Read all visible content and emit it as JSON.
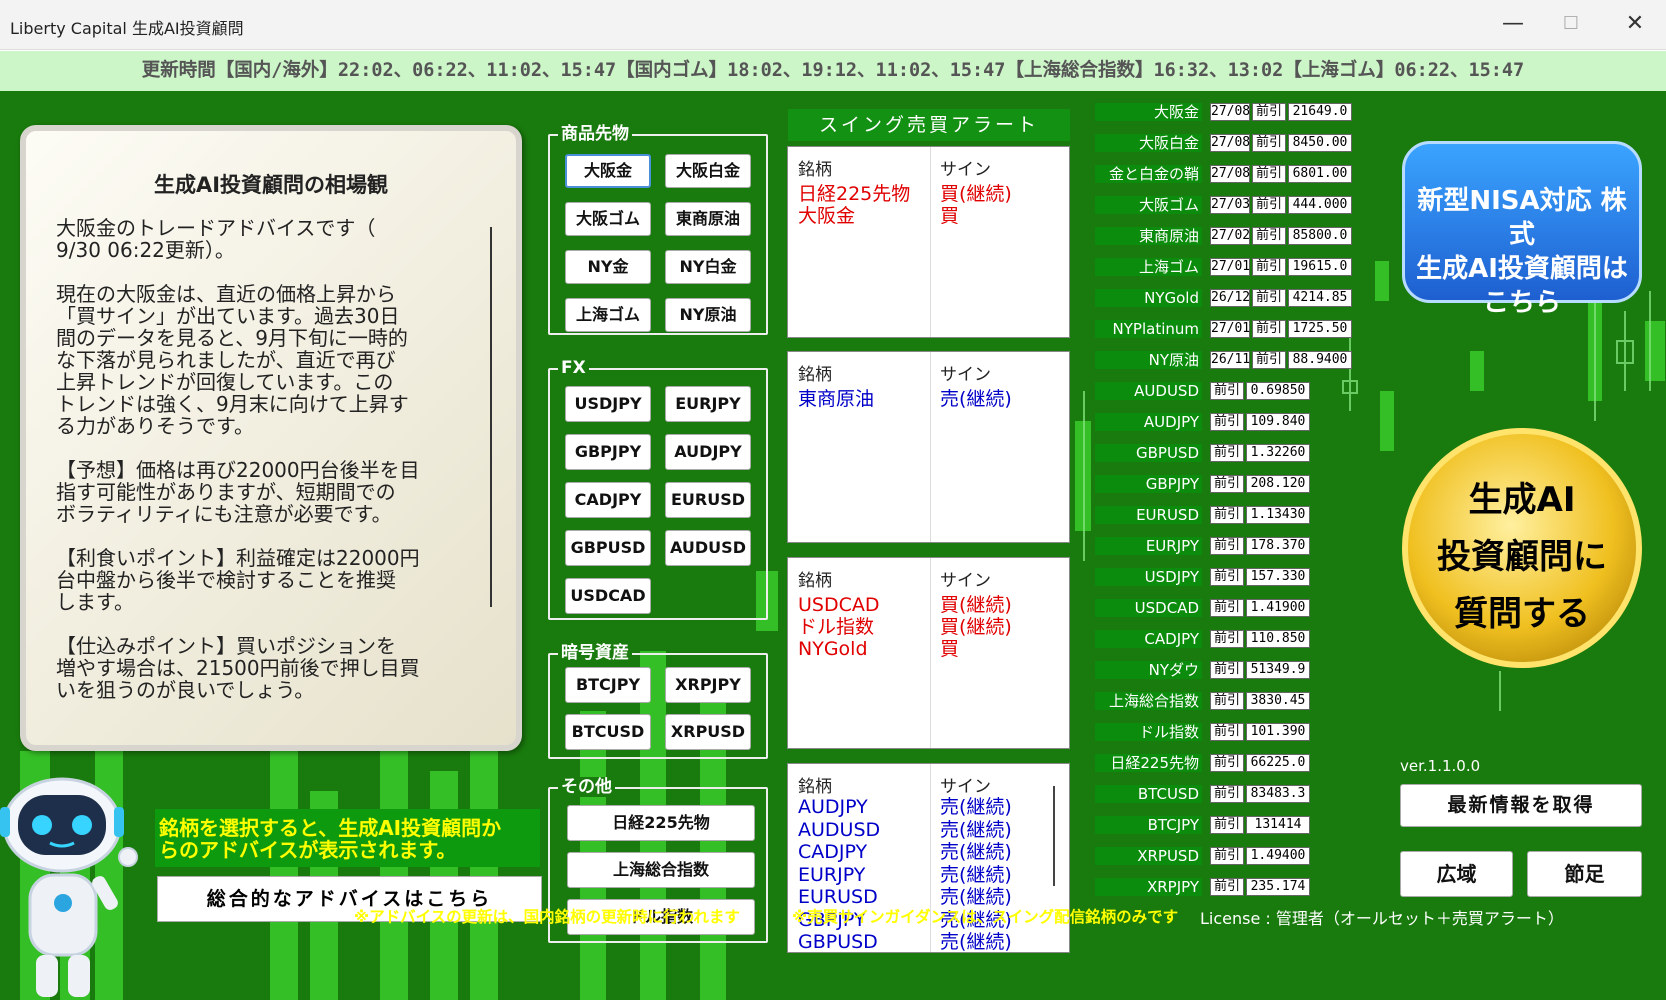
{
  "window": {
    "title": "Liberty Capital 生成AI投資顧問",
    "minimize": "—",
    "maximize": "☐",
    "close": "✕"
  },
  "update_bar": "更新時間【国内/海外】22:02、06:22、11:02、15:47【国内ゴム】18:02、19:12、11:02、15:47【上海総合指数】16:32、13:02【上海ゴム】06:22、15:47",
  "advice_panel": {
    "title": "生成AI投資顧問の相場観",
    "text": "大阪金のトレードアドバイスです（\n9/30 06:22更新）。\n\n現在の大阪金は、直近の価格上昇から\n「買サイン」が出ています。過去30日\n間のデータを見ると、9月下旬に一時的\nな下落が見られましたが、直近で再び\n上昇トレンドが回復しています。この\nトレンドは強く、9月末に向けて上昇す\nる力がありそうです。\n\n【予想】価格は再び22000円台後半を目\n指す可能性がありますが、短期間での\nボラティリティにも注意が必要です。\n\n【利食いポイント】利益確定は22000円\n台中盤から後半で検討することを推奨\nします。\n\n【仕込みポイント】買いポジションを\n増やす場合は、21500円前後で押し目買\nいを狙うのが良いでしょう。"
  },
  "groups": {
    "commodities": {
      "label": "商品先物",
      "buttons": [
        "大阪金",
        "大阪白金",
        "大阪ゴム",
        "東商原油",
        "NY金",
        "NY白金",
        "上海ゴム",
        "NY原油"
      ]
    },
    "fx": {
      "label": "FX",
      "buttons": [
        "USDJPY",
        "EURJPY",
        "GBPJPY",
        "AUDJPY",
        "CADJPY",
        "EURUSD",
        "GBPUSD",
        "AUDUSD",
        "USDCAD"
      ]
    },
    "crypto": {
      "label": "暗号資産",
      "buttons": [
        "BTCJPY",
        "XRPJPY",
        "BTCUSD",
        "XRPUSD"
      ]
    },
    "other": {
      "label": "その他",
      "buttons": [
        "日経225先物",
        "上海総合指数",
        "ドル指数"
      ]
    }
  },
  "swing": {
    "title": "スイング売買アラート",
    "col_symbol": "銘柄",
    "col_sign": "サイン",
    "panels": [
      {
        "rows": [
          {
            "symbol": "日経225先物",
            "sign": "買(継続)",
            "type": "buy"
          },
          {
            "symbol": "大阪金",
            "sign": "買",
            "type": "buy"
          }
        ]
      },
      {
        "rows": [
          {
            "symbol": "東商原油",
            "sign": "売(継続)",
            "type": "sell"
          }
        ]
      },
      {
        "rows": [
          {
            "symbol": "USDCAD",
            "sign": "買(継続)",
            "type": "buy"
          },
          {
            "symbol": "ドル指数",
            "sign": "買(継続)",
            "type": "buy"
          },
          {
            "symbol": "NYGold",
            "sign": "買",
            "type": "buy"
          }
        ]
      },
      {
        "rows": [
          {
            "symbol": "AUDJPY",
            "sign": "売(継続)",
            "type": "sell"
          },
          {
            "symbol": "AUDUSD",
            "sign": "売(継続)",
            "type": "sell"
          },
          {
            "symbol": "CADJPY",
            "sign": "売(継続)",
            "type": "sell"
          },
          {
            "symbol": "EURJPY",
            "sign": "売(継続)",
            "type": "sell"
          },
          {
            "symbol": "EURUSD",
            "sign": "売(継続)",
            "type": "sell"
          },
          {
            "symbol": "GBPJPY",
            "sign": "売(継続)",
            "type": "sell"
          },
          {
            "symbol": "GBPUSD",
            "sign": "売(継続)",
            "type": "sell"
          }
        ]
      }
    ]
  },
  "quotes": [
    {
      "name": "大阪金",
      "month": "27/08",
      "tag": "前引",
      "value": "21649.0"
    },
    {
      "name": "大阪白金",
      "month": "27/08",
      "tag": "前引",
      "value": "8450.00"
    },
    {
      "name": "金と白金の鞘",
      "month": "27/08",
      "tag": "前引",
      "value": "6801.00"
    },
    {
      "name": "大阪ゴム",
      "month": "27/03",
      "tag": "前引",
      "value": "444.000"
    },
    {
      "name": "東商原油",
      "month": "27/02",
      "tag": "前引",
      "value": "85800.0"
    },
    {
      "name": "上海ゴム",
      "month": "27/01",
      "tag": "前引",
      "value": "19615.0"
    },
    {
      "name": "NYGold",
      "month": "26/12",
      "tag": "前引",
      "value": "4214.85"
    },
    {
      "name": "NYPlatinum",
      "month": "27/01",
      "tag": "前引",
      "value": "1725.50"
    },
    {
      "name": "NY原油",
      "month": "26/11",
      "tag": "前引",
      "value": "88.9400"
    },
    {
      "name": "AUDUSD",
      "month": "",
      "tag": "前引",
      "value": "0.69850"
    },
    {
      "name": "AUDJPY",
      "month": "",
      "tag": "前引",
      "value": "109.840"
    },
    {
      "name": "GBPUSD",
      "month": "",
      "tag": "前引",
      "value": "1.32260"
    },
    {
      "name": "GBPJPY",
      "month": "",
      "tag": "前引",
      "value": "208.120"
    },
    {
      "name": "EURUSD",
      "month": "",
      "tag": "前引",
      "value": "1.13430"
    },
    {
      "name": "EURJPY",
      "month": "",
      "tag": "前引",
      "value": "178.370"
    },
    {
      "name": "USDJPY",
      "month": "",
      "tag": "前引",
      "value": "157.330"
    },
    {
      "name": "USDCAD",
      "month": "",
      "tag": "前引",
      "value": "1.41900"
    },
    {
      "name": "CADJPY",
      "month": "",
      "tag": "前引",
      "value": "110.850"
    },
    {
      "name": "NYダウ",
      "month": "",
      "tag": "前引",
      "value": "51349.9"
    },
    {
      "name": "上海総合指数",
      "month": "",
      "tag": "前引",
      "value": "3830.45"
    },
    {
      "name": "ドル指数",
      "month": "",
      "tag": "前引",
      "value": "101.390"
    },
    {
      "name": "日経225先物",
      "month": "",
      "tag": "前引",
      "value": "66225.0"
    },
    {
      "name": "BTCUSD",
      "month": "",
      "tag": "前引",
      "value": "83483.3"
    },
    {
      "name": "BTCJPY",
      "month": "",
      "tag": "前引",
      "value": "131414"
    },
    {
      "name": "XRPUSD",
      "month": "",
      "tag": "前引",
      "value": "1.49400"
    },
    {
      "name": "XRPJPY",
      "month": "",
      "tag": "前引",
      "value": "235.174"
    }
  ],
  "right": {
    "nisa_button": "新型NISA対応 株式\n生成AI投資顧問は\nこちら",
    "ask_button": "生成AI\n投資顧問に\n質問する",
    "version": "ver.1.1.0.0",
    "refresh_button": "最新情報を取得",
    "wide_button": "広域",
    "candle_button": "節足"
  },
  "hint": "銘柄を選択すると、生成AI投資顧問か\nらのアドバイスが表示されます。",
  "overall_button": "総合的なアドバイスはこちら",
  "footer": {
    "note1": "※アドバイスの更新は、国内銘柄の更新時に行われます",
    "note2": "※売買サインガイダンスは、スイング配信銘柄のみです",
    "license": "License : 管理者（オールセット＋売買アラート）"
  },
  "colors": {
    "bg_green": "#197b0d",
    "hint_text": "#ffff00",
    "buy": "#e00000",
    "sell": "#0000c8",
    "nisa_blue": "#1e5fd0",
    "ask_gold": "#f0c020"
  }
}
